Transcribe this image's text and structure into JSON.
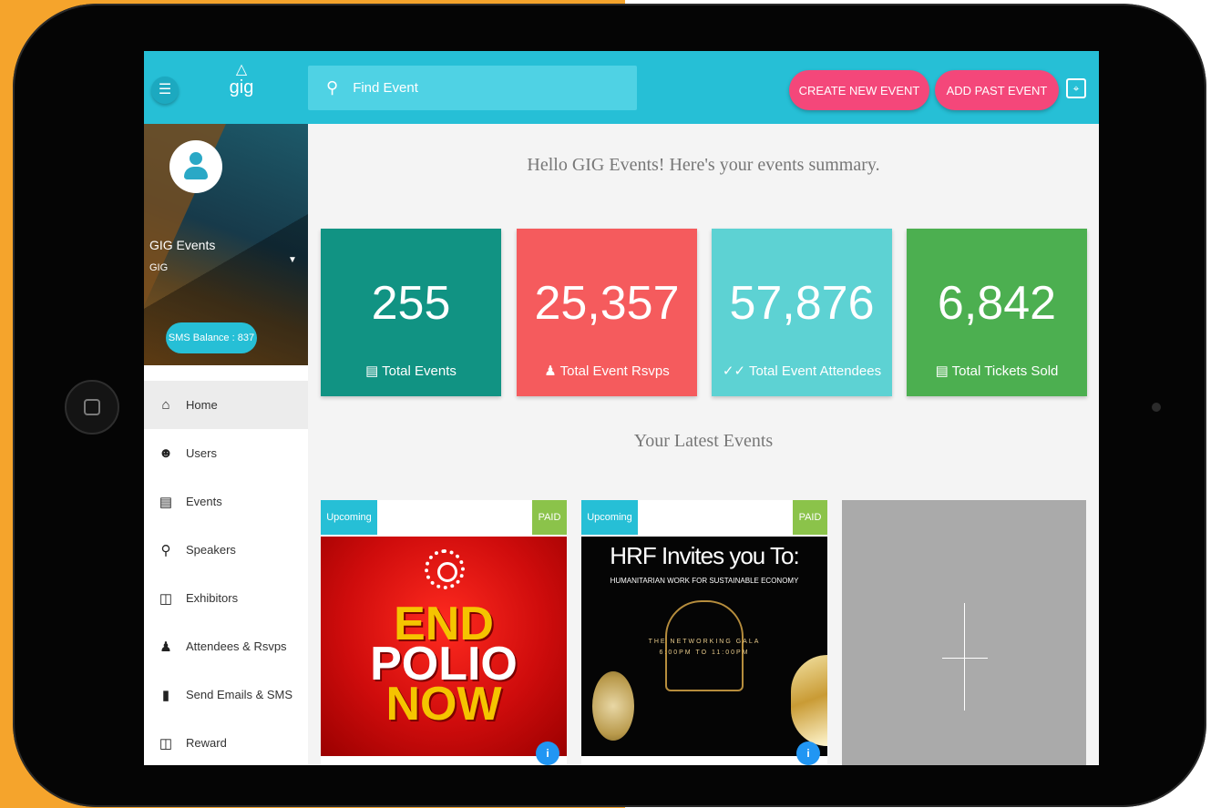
{
  "header": {
    "logo_text": "gig",
    "search_placeholder": "Find Event",
    "create_button": "CREATE NEW EVENT",
    "past_button": "ADD PAST EVENT"
  },
  "profile": {
    "name": "GIG Events",
    "org": "GIG",
    "sms_balance": "SMS Balance : 837"
  },
  "sidebar": {
    "items": [
      {
        "label": "Home",
        "icon": "home-icon"
      },
      {
        "label": "Users",
        "icon": "user-face-icon"
      },
      {
        "label": "Events",
        "icon": "list-icon"
      },
      {
        "label": "Speakers",
        "icon": "microphone-icon"
      },
      {
        "label": "Exhibitors",
        "icon": "badge-icon"
      },
      {
        "label": "Attendees & Rsvps",
        "icon": "people-icon"
      },
      {
        "label": "Send Emails & SMS",
        "icon": "message-icon"
      },
      {
        "label": "Reward",
        "icon": "gift-icon"
      }
    ]
  },
  "main": {
    "greeting": "Hello GIG Events! Here's your events summary.",
    "stats": [
      {
        "value": "255",
        "label": "Total Events",
        "color": "#119383"
      },
      {
        "value": "25,357",
        "label": "Total Event Rsvps",
        "color": "#f55b5d"
      },
      {
        "value": "57,876",
        "label": "Total Event Attendees",
        "color": "#5dd2d3"
      },
      {
        "value": "6,842",
        "label": "Total Tickets Sold",
        "color": "#4caf50"
      }
    ],
    "latest_title": "Your Latest Events",
    "events": [
      {
        "status": "Upcoming",
        "price": "PAID",
        "poster_lines": [
          "END",
          "POLIO",
          "NOW"
        ]
      },
      {
        "status": "Upcoming",
        "price": "PAID",
        "poster_title": "HRF Invites you To:",
        "poster_subtitle": "HUMANITARIAN WORK FOR SUSTAINABLE ECONOMY",
        "poster_gala": "THE NETWORKING GALA",
        "poster_time": "6:00PM TO 11:00PM"
      }
    ]
  },
  "colors": {
    "primary": "#26bfd6",
    "accent": "#f4477a",
    "background_left": "#f5a42c"
  }
}
